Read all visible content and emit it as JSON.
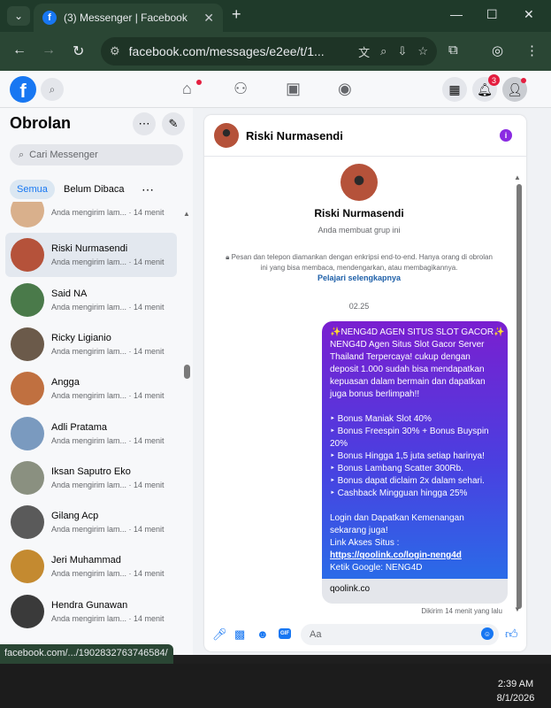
{
  "browser": {
    "tab_title": "(3) Messenger | Facebook",
    "url": "facebook.com/messages/e2ee/t/1...",
    "status_url": "facebook.com/.../1902832763746584/"
  },
  "header": {
    "notification_count": "3"
  },
  "sidebar": {
    "title": "Obrolan",
    "search_placeholder": "Cari Messenger",
    "filters": {
      "all": "Semua",
      "unread": "Belum Dibaca"
    },
    "chats": [
      {
        "name": "",
        "preview": "Anda mengirim lam... · 14 menit",
        "avatar_color": "#d9b08c"
      },
      {
        "name": "Riski Nurmasendi",
        "preview": "Anda mengirim lam... · 14 menit",
        "avatar_color": "#b5523a",
        "selected": true
      },
      {
        "name": "Said NA",
        "preview": "Anda mengirim lam... · 14 menit",
        "avatar_color": "#4a7a4a"
      },
      {
        "name": "Ricky Ligianio",
        "preview": "Anda mengirim lam... · 14 menit",
        "avatar_color": "#6b5a4a"
      },
      {
        "name": "Angga",
        "preview": "Anda mengirim lam... · 14 menit",
        "avatar_color": "#c07040"
      },
      {
        "name": "Adli Pratama",
        "preview": "Anda mengirim lam... · 14 menit",
        "avatar_color": "#7a9abf"
      },
      {
        "name": "Iksan Saputro Eko",
        "preview": "Anda mengirim lam... · 14 menit",
        "avatar_color": "#8a9080"
      },
      {
        "name": "Gilang Acp",
        "preview": "Anda mengirim lam... · 14 menit",
        "avatar_color": "#5a5a5a"
      },
      {
        "name": "Jeri Muhammad",
        "preview": "Anda mengirim lam... · 14 menit",
        "avatar_color": "#c48a30"
      },
      {
        "name": "Hendra Gunawan",
        "preview": "Anda mengirim lam... · 14 menit",
        "avatar_color": "#3a3a3a"
      }
    ]
  },
  "conversation": {
    "name": "Riski Nurmasendi",
    "group_note": "Anda membuat grup ini",
    "e2e_notice": "Pesan dan telepon diamankan dengan enkripsi end-to-end. Hanya orang di obrolan ini yang bisa membaca, mendengarkan, atau membagikannya.",
    "learn_more": "Pelajari selengkapnya",
    "timestamp": "02.25",
    "message_lines": [
      "✨NENG4D AGEN SITUS SLOT GACOR✨",
      "NENG4D Agen Situs Slot Gacor Server",
      "Thailand Terpercaya! cukup dengan",
      "deposit 1.000 sudah bisa mendapatkan",
      "kepuasan dalam bermain dan dapatkan",
      "juga bonus berlimpah!!",
      "",
      "‣ Bonus Maniak Slot 40%",
      "‣ Bonus Freespin 30% + Bonus Buyspin",
      "20%",
      "‣ Bonus Hingga 1,5 juta setiap harinya!",
      "‣ Bonus Lambang Scatter 300Rb.",
      "‣ Bonus dapat diclaim 2x dalam sehari.",
      "‣ Cashback Mingguan hingga 25%",
      "",
      "Login dan Dapatkan Kemenangan",
      "sekarang juga!",
      "Link Akses Situs :"
    ],
    "message_link": "https://qoolink.co/login-neng4d",
    "message_footer": "Ketik Google: NENG4D",
    "link_preview": "qoolink.co",
    "sent_status": "Dikirim 14 menit yang lalu",
    "input_placeholder": "Aa"
  },
  "taskbar": {
    "time": "2:39 AM",
    "date": "8/1/2026"
  }
}
